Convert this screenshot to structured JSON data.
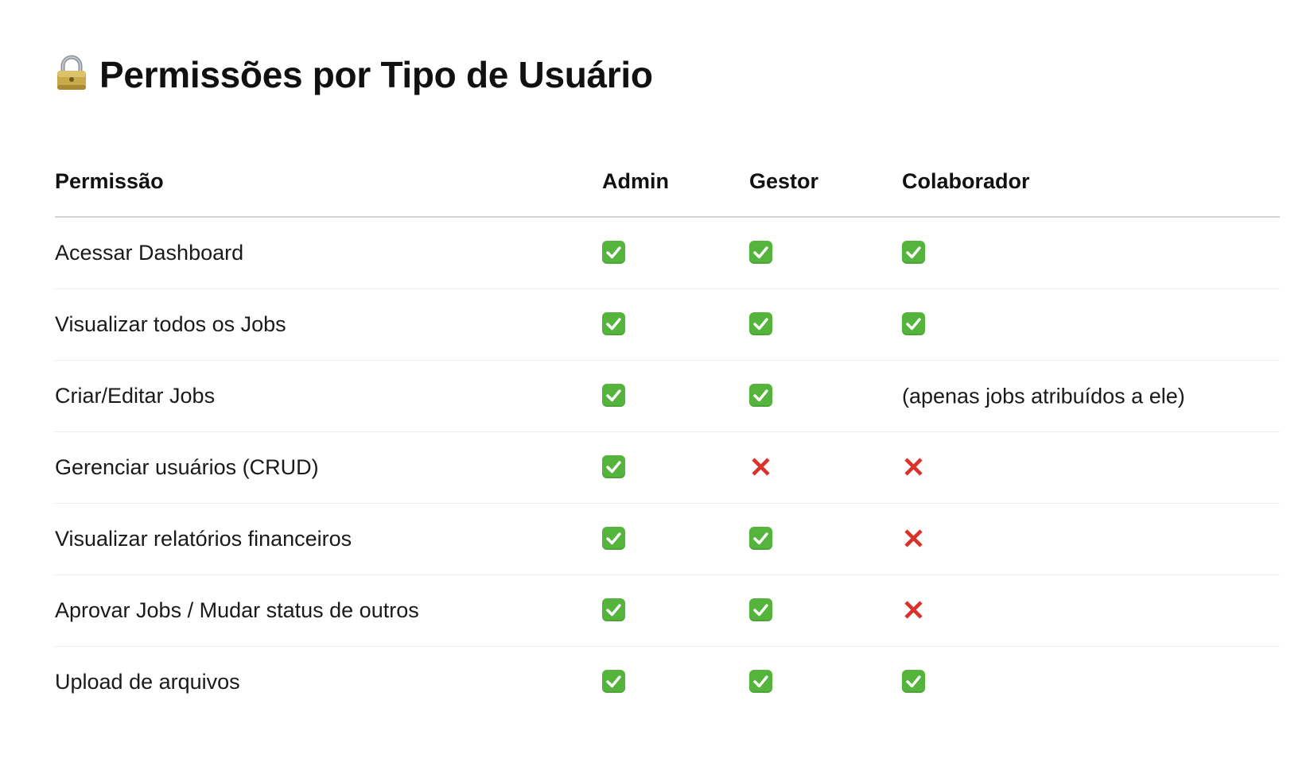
{
  "title": {
    "icon": "lock-icon",
    "text": "Permissões por Tipo de Usuário"
  },
  "table": {
    "headers": [
      "Permissão",
      "Admin",
      "Gestor",
      "Colaborador"
    ],
    "rows": [
      {
        "label": "Acessar Dashboard",
        "admin": {
          "type": "check"
        },
        "gestor": {
          "type": "check"
        },
        "colaborador": {
          "type": "check"
        }
      },
      {
        "label": "Visualizar todos os Jobs",
        "admin": {
          "type": "check"
        },
        "gestor": {
          "type": "check"
        },
        "colaborador": {
          "type": "check"
        }
      },
      {
        "label": "Criar/Editar Jobs",
        "admin": {
          "type": "check"
        },
        "gestor": {
          "type": "check"
        },
        "colaborador": {
          "type": "text",
          "text": "(apenas jobs atribuídos a ele)"
        }
      },
      {
        "label": "Gerenciar usuários (CRUD)",
        "admin": {
          "type": "check"
        },
        "gestor": {
          "type": "cross"
        },
        "colaborador": {
          "type": "cross"
        }
      },
      {
        "label": "Visualizar relatórios financeiros",
        "admin": {
          "type": "check"
        },
        "gestor": {
          "type": "check"
        },
        "colaborador": {
          "type": "cross"
        }
      },
      {
        "label": "Aprovar Jobs / Mudar status de outros",
        "admin": {
          "type": "check"
        },
        "gestor": {
          "type": "check"
        },
        "colaborador": {
          "type": "cross"
        }
      },
      {
        "label": "Upload de arquivos",
        "admin": {
          "type": "check"
        },
        "gestor": {
          "type": "check"
        },
        "colaborador": {
          "type": "check"
        }
      }
    ]
  },
  "colors": {
    "check": "#54b43c",
    "cross": "#d8322a",
    "lock_body": "#c9a94a"
  }
}
